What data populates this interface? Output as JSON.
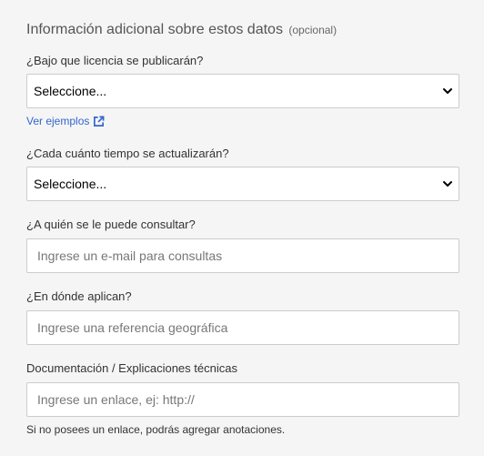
{
  "section": {
    "title": "Información adicional sobre estos datos",
    "optional": "(opcional)"
  },
  "license": {
    "label": "¿Bajo que licencia se publicarán?",
    "value": "Seleccione...",
    "examples_link": "Ver ejemplos"
  },
  "frequency": {
    "label": "¿Cada cuánto tiempo se actualizarán?",
    "value": "Seleccione..."
  },
  "contact": {
    "label": "¿A quién se le puede consultar?",
    "placeholder": "Ingrese un e-mail para consultas"
  },
  "location": {
    "label": "¿En dónde aplican?",
    "placeholder": "Ingrese una referencia geográfica"
  },
  "documentation": {
    "label": "Documentación / Explicaciones técnicas",
    "placeholder": "Ingrese un enlace, ej: http://",
    "hint": "Si no posees un enlace, podrás agregar anotaciones."
  },
  "icons": {
    "select_arrow": "chevron-down-icon",
    "examples_link": "external-link-icon"
  },
  "colors": {
    "link": "#3366cc",
    "border": "#cccccc",
    "background": "#f5f5f5"
  }
}
